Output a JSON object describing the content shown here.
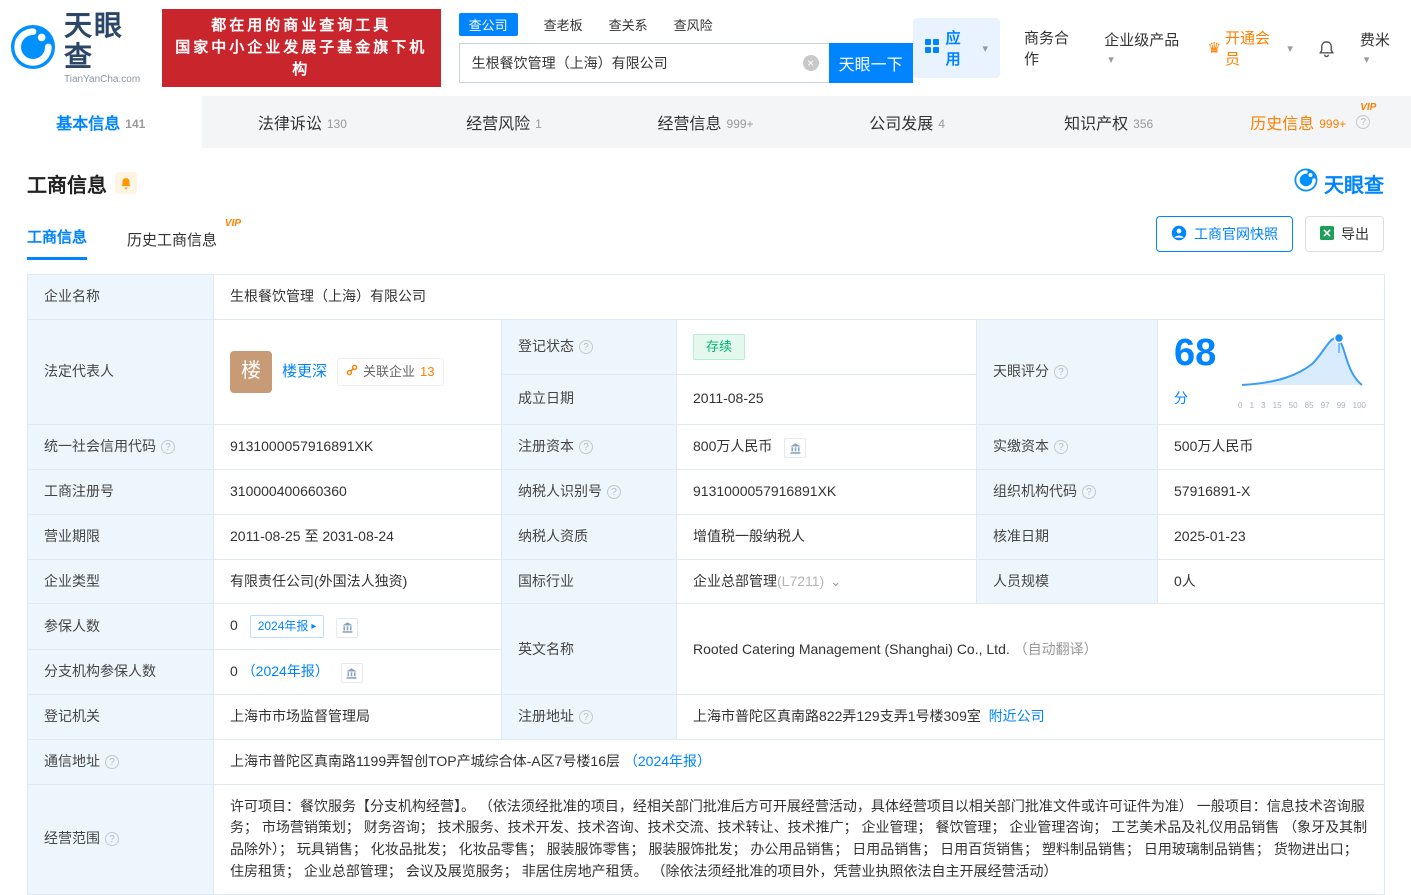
{
  "header": {
    "brand": "天眼查",
    "brand_domain": "TianYanCha.com",
    "banner_line1": "都在用的商业查询工具",
    "banner_line2": "国家中小企业发展子基金旗下机构",
    "search_tabs": [
      {
        "label": "查公司"
      },
      {
        "label": "查老板"
      },
      {
        "label": "查关系"
      },
      {
        "label": "查风险"
      }
    ],
    "search_value": "生根餐饮管理（上海）有限公司",
    "search_button": "天眼一下",
    "menu_app": "应用",
    "menu_cooperation": "商务合作",
    "menu_enterprise": "企业级产品",
    "menu_vip": "开通会员",
    "menu_user": "费米"
  },
  "nav_tabs": [
    {
      "label": "基本信息",
      "count": "141"
    },
    {
      "label": "法律诉讼",
      "count": "130"
    },
    {
      "label": "经营风险",
      "count": "1"
    },
    {
      "label": "经营信息",
      "count": "999+"
    },
    {
      "label": "公司发展",
      "count": "4"
    },
    {
      "label": "知识产权",
      "count": "356"
    },
    {
      "label": "历史信息",
      "count": "999+",
      "vip": "VIP"
    }
  ],
  "section": {
    "title": "工商信息",
    "brand": "天眼查",
    "tab_current": "工商信息",
    "tab_history": "历史工商信息",
    "vip": "VIP",
    "btn_snapshot": "工商官网快照",
    "btn_export": "导出"
  },
  "fields": {
    "company_name": {
      "label": "企业名称",
      "value": "生根餐饮管理（上海）有限公司"
    },
    "legal_rep": {
      "label": "法定代表人",
      "avatar": "楼",
      "name": "楼更深",
      "related_label": "关联企业",
      "related_count": "13"
    },
    "reg_status": {
      "label": "登记状态",
      "value": "存续"
    },
    "establish_date": {
      "label": "成立日期",
      "value": "2011-08-25"
    },
    "score": {
      "label": "天眼评分",
      "value": "68",
      "unit": "分",
      "axis_ticks": [
        "0",
        "1",
        "3",
        "15",
        "50",
        "85",
        "97",
        "99",
        "100"
      ]
    },
    "credit_code": {
      "label": "统一社会信用代码",
      "value": "9131000057916891XK"
    },
    "reg_capital": {
      "label": "注册资本",
      "value": "800万人民币"
    },
    "paid_capital": {
      "label": "实缴资本",
      "value": "500万人民币"
    },
    "reg_number": {
      "label": "工商注册号",
      "value": "310000400660360"
    },
    "taxpayer_id": {
      "label": "纳税人识别号",
      "value": "9131000057916891XK"
    },
    "org_code": {
      "label": "组织机构代码",
      "value": "57916891-X"
    },
    "business_term": {
      "label": "营业期限",
      "value": "2011-08-25 至 2031-08-24"
    },
    "taxpayer_quality": {
      "label": "纳税人资质",
      "value": "增值税一般纳税人"
    },
    "approve_date": {
      "label": "核准日期",
      "value": "2025-01-23"
    },
    "company_type": {
      "label": "企业类型",
      "value": "有限责任公司(外国法人独资)"
    },
    "industry": {
      "label": "国标行业",
      "value": "企业总部管理",
      "code": "(L7211)"
    },
    "staff_size": {
      "label": "人员规模",
      "value": "0人"
    },
    "insured_count": {
      "label": "参保人数",
      "value": "0",
      "report_link": "2024年报"
    },
    "branch_insured": {
      "label": "分支机构参保人数",
      "value": "0",
      "report_link": "（2024年报）"
    },
    "english_name": {
      "label": "英文名称",
      "value": "Rooted Catering Management (Shanghai) Co., Ltd.",
      "note": "（自动翻译）"
    },
    "reg_authority": {
      "label": "登记机关",
      "value": "上海市市场监督管理局"
    },
    "reg_address": {
      "label": "注册地址",
      "value": "上海市普陀区真南路822弄129支弄1号楼309室",
      "nearby_link": "附近公司"
    },
    "postal_address": {
      "label": "通信地址",
      "value": "上海市普陀区真南路1199弄智创TOP产城综合体-A区7号楼16层",
      "report_link": "（2024年报）"
    },
    "business_scope": {
      "label": "经营范围",
      "value": "许可项目：餐饮服务【分支机构经营】。 （依法须经批准的项目，经相关部门批准后方可开展经营活动，具体经营项目以相关部门批准文件或许可证件为准） 一般项目：信息技术咨询服务； 市场营销策划； 财务咨询； 技术服务、技术开发、技术咨询、技术交流、技术转让、技术推广； 企业管理； 餐饮管理； 企业管理咨询； 工艺美术品及礼仪用品销售 （象牙及其制品除外）； 玩具销售； 化妆品批发； 化妆品零售； 服装服饰零售； 服装服饰批发； 办公用品销售； 日用品销售； 日用百货销售； 塑料制品销售； 日用玻璃制品销售； 货物进出口； 住房租赁； 企业总部管理； 会议及展览服务； 非居住房地产租赁。 （除依法须经批准的项目外，凭营业执照依法自主开展经营活动）"
    }
  },
  "colors": {
    "accent": "#0084ff",
    "vip_orange": "#ff8000",
    "status_green": "#00b578",
    "banner_red": "#c9252c"
  }
}
